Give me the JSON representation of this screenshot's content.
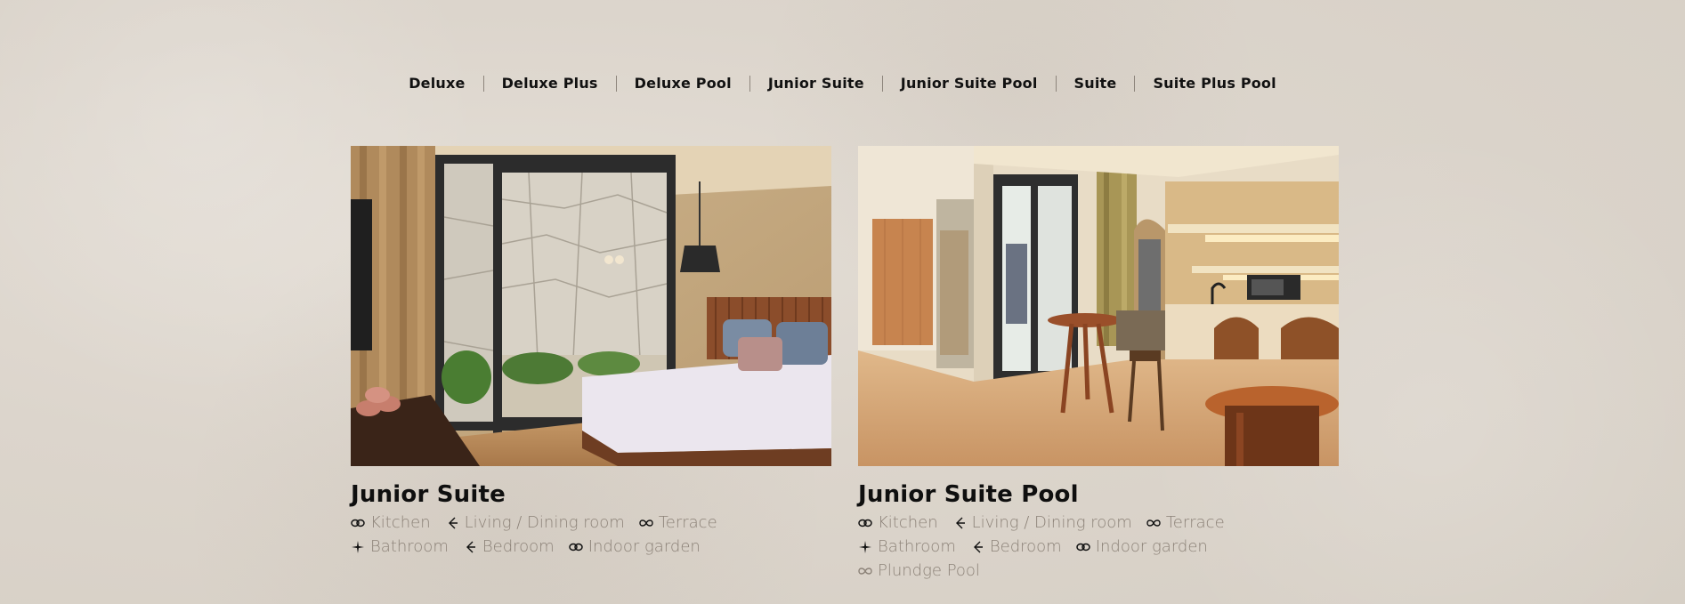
{
  "nav": {
    "items": [
      {
        "label": "Deluxe"
      },
      {
        "label": "Deluxe Plus"
      },
      {
        "label": "Deluxe Pool"
      },
      {
        "label": "Junior Suite"
      },
      {
        "label": "Junior Suite Pool"
      },
      {
        "label": "Suite"
      },
      {
        "label": "Suite Plus Pool"
      }
    ]
  },
  "rooms": [
    {
      "title": "Junior Suite",
      "photo_icon": "bedroom-photo",
      "amenities": [
        [
          {
            "icon": "chain-link-icon",
            "label": "Kitchen"
          },
          {
            "icon": "arrow-left-icon",
            "label": "Living / Dining room"
          },
          {
            "icon": "infinity-icon",
            "label": "Terrace"
          }
        ],
        [
          {
            "icon": "sparkle-icon",
            "label": "Bathroom"
          },
          {
            "icon": "arrow-left-icon",
            "label": "Bedroom"
          },
          {
            "icon": "chain-link-icon",
            "label": "Indoor garden"
          }
        ]
      ]
    },
    {
      "title": "Junior Suite Pool",
      "photo_icon": "kitchen-living-photo",
      "amenities": [
        [
          {
            "icon": "chain-link-icon",
            "label": "Kitchen"
          },
          {
            "icon": "arrow-left-icon",
            "label": "Living / Dining room"
          },
          {
            "icon": "infinity-icon",
            "label": "Terrace"
          }
        ],
        [
          {
            "icon": "sparkle-icon",
            "label": "Bathroom"
          },
          {
            "icon": "arrow-left-icon",
            "label": "Bedroom"
          },
          {
            "icon": "chain-link-icon",
            "label": "Indoor garden"
          }
        ],
        [
          {
            "icon": "infinity-icon",
            "label": "Plundge Pool"
          }
        ]
      ]
    }
  ],
  "colors": {
    "background": "#dcd5cc",
    "text": "#111111",
    "amenity_text": "#8c8278",
    "separator": "#8d857c"
  }
}
